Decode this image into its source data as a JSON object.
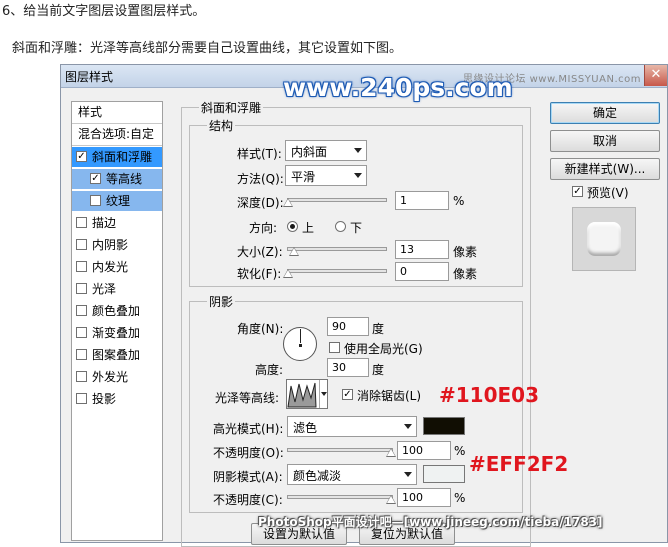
{
  "article": {
    "heading": "6、给当前文字图层设置图层样式。",
    "subheading": "斜面和浮雕：光泽等高线部分需要自己设置曲线，其它设置如下图。"
  },
  "watermarks": {
    "site_big": "www.240ps.com",
    "site_right": "思缘设计论坛  www.MISSYUAN.com",
    "footer": "PhotoShop平面设计吧—[www.jineeg.com/tieba/1783]"
  },
  "dialog": {
    "title": "图层样式",
    "close_glyph": "✕",
    "style_list": {
      "header": "样式",
      "blend_options": "混合选项:自定",
      "items": [
        {
          "label": "斜面和浮雕",
          "checked": true
        },
        {
          "label": "等高线",
          "checked": true
        },
        {
          "label": "纹理",
          "checked": false
        },
        {
          "label": "描边",
          "checked": false
        },
        {
          "label": "内阴影",
          "checked": false
        },
        {
          "label": "内发光",
          "checked": false
        },
        {
          "label": "光泽",
          "checked": false
        },
        {
          "label": "颜色叠加",
          "checked": false
        },
        {
          "label": "渐变叠加",
          "checked": false
        },
        {
          "label": "图案叠加",
          "checked": false
        },
        {
          "label": "外发光",
          "checked": false
        },
        {
          "label": "投影",
          "checked": false
        }
      ]
    },
    "panel": {
      "title": "斜面和浮雕",
      "structure": {
        "title": "结构",
        "style_label": "样式(T):",
        "style_value": "内斜面",
        "technique_label": "方法(Q):",
        "technique_value": "平滑",
        "depth_label": "深度(D):",
        "depth_value": "1",
        "depth_unit": "%",
        "direction_label": "方向:",
        "dir_up": "上",
        "dir_down": "下",
        "size_label": "大小(Z):",
        "size_value": "13",
        "size_unit": "像素",
        "soften_label": "软化(F):",
        "soften_value": "0",
        "soften_unit": "像素"
      },
      "shading": {
        "title": "阴影",
        "angle_label": "角度(N):",
        "angle_value": "90",
        "angle_unit": "度",
        "global_light_label": "使用全局光(G)",
        "altitude_label": "高度:",
        "altitude_value": "30",
        "altitude_unit": "度",
        "gloss_contour_label": "光泽等高线:",
        "anti_alias_label": "消除锯齿(L)",
        "highlight_mode_label": "高光模式(H):",
        "highlight_mode_value": "滤色",
        "highlight_opacity_label": "不透明度(O):",
        "highlight_opacity_value": "100",
        "highlight_opacity_unit": "%",
        "shadow_mode_label": "阴影模式(A):",
        "shadow_mode_value": "颜色减淡",
        "shadow_opacity_label": "不透明度(C):",
        "shadow_opacity_value": "100",
        "shadow_opacity_unit": "%"
      },
      "make_default": "设置为默认值",
      "reset_default": "复位为默认值"
    },
    "buttons": {
      "ok": "确定",
      "cancel": "取消",
      "new_style": "新建样式(W)...",
      "preview": "预览(V)"
    }
  },
  "annotations": {
    "highlight_color": "#110E03",
    "shadow_color": "#EFF2F2"
  },
  "colors": {
    "highlight_swatch": "#110e03",
    "shadow_swatch": "#eff2f2",
    "annotation_red": "#e0161e",
    "selection_blue": "#3399ff"
  }
}
